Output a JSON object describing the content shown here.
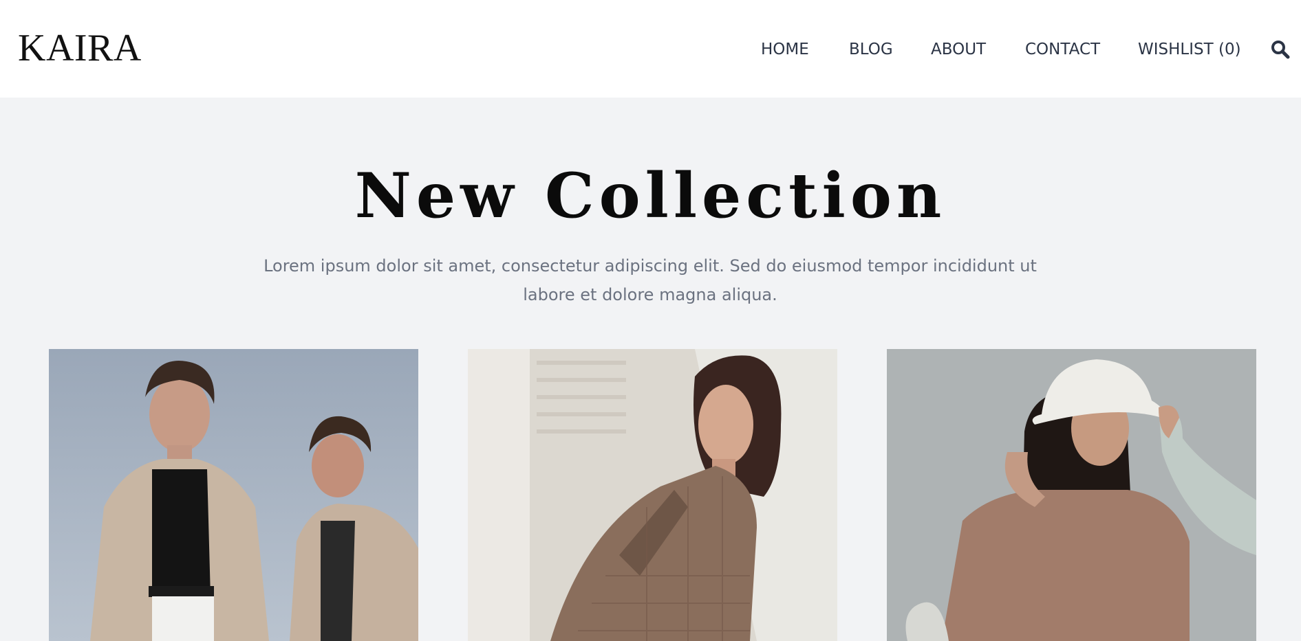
{
  "brand": {
    "logo": "KAIRA"
  },
  "nav": {
    "items": [
      {
        "label": "HOME"
      },
      {
        "label": "BLOG"
      },
      {
        "label": "ABOUT"
      },
      {
        "label": "CONTACT"
      },
      {
        "label": "WISHLIST (0)"
      }
    ],
    "search_icon": "search-icon"
  },
  "hero": {
    "title": "New Collection",
    "description": "Lorem ipsum dolor sit amet, consectetur adipiscing elit. Sed do eiusmod tempor incididunt ut labore et dolore magna aliqua."
  },
  "products": [
    {
      "image": "two-models-beige-jackets-photo"
    },
    {
      "image": "model-checked-blazer-photo"
    },
    {
      "image": "model-bucket-hat-photo"
    }
  ],
  "colors": {
    "header_bg": "#ffffff",
    "page_bg": "#f2f3f5",
    "nav_text": "#2b3445",
    "body_text": "#6b7280",
    "title_text": "#0b0b0b"
  }
}
